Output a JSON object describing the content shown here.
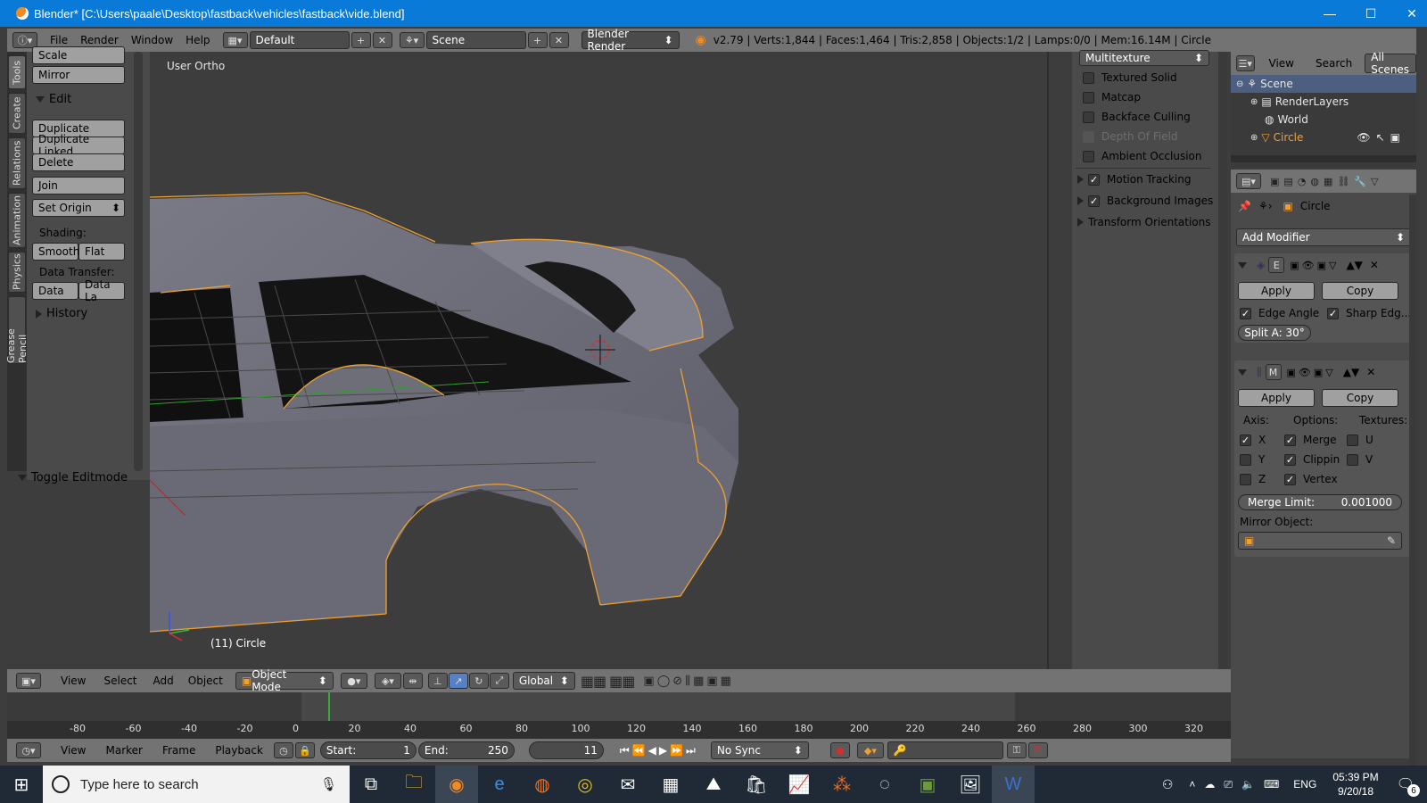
{
  "window": {
    "title": "Blender* [C:\\Users\\paale\\Desktop\\fastback\\vehicles\\fastback\\vide.blend]",
    "minimize": "—",
    "maximize": "☐",
    "close": "✕"
  },
  "info_header": {
    "menus": [
      "File",
      "Render",
      "Window",
      "Help"
    ],
    "layout": "Default",
    "scene": "Scene",
    "engine": "Blender Render",
    "stats": "v2.79 | Verts:1,844 | Faces:1,464 | Tris:2,858 | Objects:1/2 | Lamps:0/0 | Mem:16.14M | Circle"
  },
  "tool_tabs": [
    "Tools",
    "Create",
    "Relations",
    "Animation",
    "Physics",
    "Grease Pencil"
  ],
  "tool_shelf": {
    "top_buttons": [
      "Scale",
      "Mirror"
    ],
    "edit_header": "Edit",
    "edit_buttons": [
      "Duplicate",
      "Duplicate Linked",
      "Delete"
    ],
    "join": "Join",
    "set_origin": "Set Origin",
    "shading_label": "Shading:",
    "smooth": "Smooth",
    "flat": "Flat",
    "data_transfer_label": "Data Transfer:",
    "data": "Data",
    "data_layout": "Data La",
    "history": "History",
    "toggle_editmode": "Toggle Editmode"
  },
  "viewport": {
    "view_label": "User Ortho",
    "object_label": "(11) Circle"
  },
  "n_panel": {
    "shading_mode": "Multitexture",
    "options": [
      {
        "label": "Textured Solid",
        "checked": false,
        "disabled": false
      },
      {
        "label": "Matcap",
        "checked": false,
        "disabled": false
      },
      {
        "label": "Backface Culling",
        "checked": false,
        "disabled": false
      },
      {
        "label": "Depth Of Field",
        "checked": false,
        "disabled": true
      },
      {
        "label": "Ambient Occlusion",
        "checked": false,
        "disabled": false
      }
    ],
    "motion_tracking": "Motion Tracking",
    "background_images": "Background Images",
    "transform_orientations": "Transform Orientations"
  },
  "outliner": {
    "view": "View",
    "search": "Search",
    "all_scenes": "All Scenes",
    "items": [
      "Scene",
      "RenderLayers",
      "World",
      "Circle"
    ]
  },
  "properties": {
    "object_name": "Circle",
    "add_modifier": "Add Modifier",
    "mod1": {
      "tag": "E",
      "apply": "Apply",
      "copy": "Copy",
      "edge_angle": "Edge Angle",
      "sharp_edges": "Sharp Edg...",
      "split_angle": "Split A: 30°"
    },
    "mod2": {
      "tag": "M",
      "apply": "Apply",
      "copy": "Copy",
      "axis_label": "Axis:",
      "options_label": "Options:",
      "textures_label": "Textures:",
      "axis": [
        {
          "label": "X",
          "checked": true
        },
        {
          "label": "Y",
          "checked": false
        },
        {
          "label": "Z",
          "checked": false
        }
      ],
      "options": [
        {
          "label": "Merge",
          "checked": true
        },
        {
          "label": "Clippin",
          "checked": true
        },
        {
          "label": "Vertex",
          "checked": true
        }
      ],
      "textures": [
        {
          "label": "U",
          "checked": false
        },
        {
          "label": "V",
          "checked": false
        }
      ],
      "merge_limit_label": "Merge Limit:",
      "merge_limit_value": "0.001000",
      "mirror_object_label": "Mirror Object:"
    }
  },
  "view3d_header": {
    "menus": [
      "View",
      "Select",
      "Add",
      "Object"
    ],
    "mode": "Object Mode",
    "orientation": "Global"
  },
  "timeline": {
    "ruler": [
      "-80",
      "-60",
      "-40",
      "-20",
      "0",
      "20",
      "40",
      "60",
      "80",
      "100",
      "120",
      "140",
      "160",
      "180",
      "200",
      "220",
      "240",
      "260",
      "280",
      "300",
      "320"
    ],
    "current_frame_marker": 11,
    "range_end": 250
  },
  "timeline_header": {
    "menus": [
      "View",
      "Marker",
      "Frame",
      "Playback"
    ],
    "start_label": "Start:",
    "start_value": "1",
    "end_label": "End:",
    "end_value": "250",
    "current": "11",
    "sync": "No Sync"
  },
  "taskbar": {
    "search_placeholder": "Type here to search",
    "language": "ENG",
    "time": "05:39 PM",
    "date": "9/20/18",
    "notifications": "6"
  }
}
